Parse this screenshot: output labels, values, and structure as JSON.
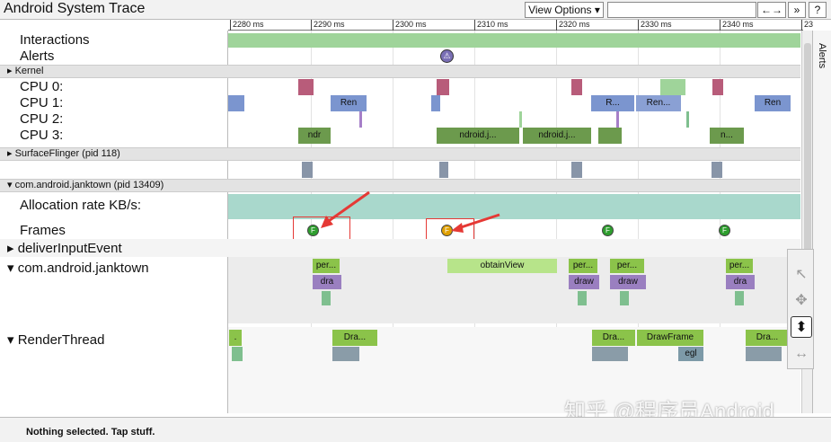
{
  "app": {
    "title": "Android System Trace"
  },
  "toolbar": {
    "view_options": "View Options ▾",
    "zoom_fit": "←→",
    "next": "»",
    "help": "?"
  },
  "ruler": {
    "ticks": [
      "2280 ms",
      "2290 ms",
      "2300 ms",
      "2310 ms",
      "2320 ms",
      "2330 ms",
      "2340 ms",
      "23"
    ]
  },
  "tracks": {
    "interactions": "Interactions",
    "alerts": "Alerts",
    "kernel": "Kernel",
    "cpu0": "CPU 0:",
    "cpu1": "CPU 1:",
    "cpu2": "CPU 2:",
    "cpu3": "CPU 3:",
    "surfaceflinger": "SurfaceFlinger (pid 118)",
    "janktown": "com.android.janktown (pid 13409)",
    "allocation": "Allocation rate KB/s:",
    "frames": "Frames",
    "deliver": "deliverInputEvent",
    "janktown_thread": "com.android.janktown",
    "renderthread": "RenderThread"
  },
  "arrows": {
    "expanded": "▾",
    "collapsed": "▸"
  },
  "slices": {
    "cpu1_a": "Ren",
    "cpu1_b": "R...",
    "cpu1_c": "Ren...",
    "cpu1_d": "Ren",
    "cpu3_a": "ndr",
    "cpu3_b": "ndroid.j...",
    "cpu3_c": "ndroid.j...",
    "cpu3_d": "n...",
    "jt_per1": "per...",
    "jt_dra1": "dra",
    "jt_obtain": "obtainView",
    "jt_per2": "per...",
    "jt_draw2": "draw",
    "jt_per3": "per...",
    "jt_draw3": "draw",
    "jt_per4": "per...",
    "jt_dra4": "dra",
    "rt_dra1": "Dra...",
    "rt_dra2": "Dra...",
    "rt_drawframe": "DrawFrame",
    "rt_egl": "egl",
    "rt_dra3": "Dra...",
    "rt_left": "."
  },
  "frames": {
    "label": "F",
    "good_color": "#2e9e2e",
    "janky_color": "#e0a000"
  },
  "alert_icon": "⚠",
  "right_panel": {
    "tab": "Alerts"
  },
  "tools": {
    "select": "↖",
    "pan": "✥",
    "zoom": "⬍",
    "timing": "↔"
  },
  "status": {
    "text": "Nothing selected. Tap stuff."
  },
  "watermark": "知乎 @程序员Android",
  "colors": {
    "interactions": "#9fd49a",
    "allocation": "#a9d8cc",
    "header": "#e3e3e3"
  }
}
